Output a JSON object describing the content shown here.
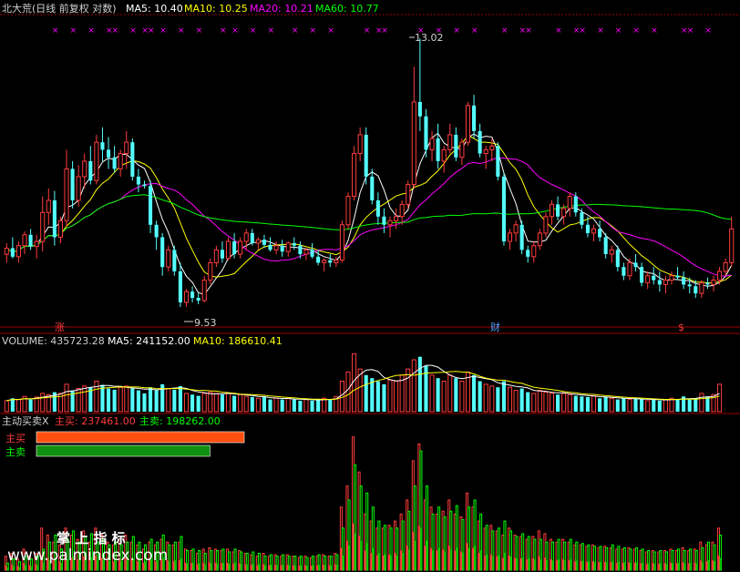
{
  "colors": {
    "up": "#ff3c3c",
    "down": "#54ffff",
    "ma5": "#ffffff",
    "ma10": "#ffff00",
    "ma20": "#ff00ff",
    "ma60": "#00ff00",
    "buy": "#ff3c10",
    "sell": "#10b010",
    "grid": "#9b0000",
    "label": "#d0d0d0"
  },
  "price_panel": {
    "title": "北大荒(日线 前复权 对数)",
    "ma5": "MA5: 10.40",
    "ma10": "MA10: 10.25",
    "ma20": "MA20: 10.21",
    "ma60": "MA60: 10.77",
    "high_label": "13.02",
    "low_label": "9.53",
    "marker_zhang": "涨",
    "marker_cai": "财",
    "marker_dollar": "$"
  },
  "volume_panel": {
    "title": "VOLUME: 435723.28",
    "ma5": "MA5: 241152.00",
    "ma10": "MA10: 186610.41"
  },
  "flow_panel": {
    "title": "主动买卖X",
    "buy_label": "主买: 237461.00",
    "sell_label": "主卖: 198262.00",
    "legend_buy": "主买",
    "legend_sell": "主卖",
    "buy_value": 237461.0,
    "sell_value": 198262.0
  },
  "watermark": {
    "line1": "掌 上 指 标",
    "line2": "www.palmindex.com"
  },
  "chart_data": {
    "type": "candlestick",
    "log_scale": true,
    "ylim": [
      9.4,
      13.3
    ],
    "price_high": 13.02,
    "price_low": 9.53,
    "candles": [
      [
        10.15,
        10.28,
        10.05,
        10.22
      ],
      [
        10.22,
        10.35,
        10.1,
        10.12
      ],
      [
        10.12,
        10.3,
        10.05,
        10.25
      ],
      [
        10.25,
        10.42,
        10.15,
        10.38
      ],
      [
        10.38,
        10.45,
        10.2,
        10.24
      ],
      [
        10.24,
        10.38,
        10.1,
        10.3
      ],
      [
        10.3,
        10.85,
        10.18,
        10.65
      ],
      [
        10.65,
        10.95,
        10.5,
        10.8
      ],
      [
        10.8,
        10.92,
        10.25,
        10.35
      ],
      [
        10.35,
        10.6,
        10.28,
        10.55
      ],
      [
        10.55,
        11.45,
        10.48,
        11.2
      ],
      [
        11.2,
        11.3,
        10.7,
        10.8
      ],
      [
        10.8,
        11.25,
        10.72,
        11.1
      ],
      [
        11.1,
        11.4,
        10.95,
        11.3
      ],
      [
        11.3,
        11.5,
        11.0,
        11.05
      ],
      [
        11.05,
        11.65,
        11.0,
        11.55
      ],
      [
        11.55,
        11.75,
        11.3,
        11.45
      ],
      [
        11.45,
        11.62,
        11.2,
        11.35
      ],
      [
        11.35,
        11.5,
        11.15,
        11.2
      ],
      [
        11.2,
        11.45,
        11.1,
        11.4
      ],
      [
        11.4,
        11.7,
        11.2,
        11.55
      ],
      [
        11.55,
        11.6,
        11.05,
        11.1
      ],
      [
        11.1,
        11.2,
        10.9,
        11.0
      ],
      [
        11.0,
        11.05,
        10.95,
        10.98
      ],
      [
        10.98,
        11.05,
        10.4,
        10.5
      ],
      [
        10.5,
        10.55,
        10.2,
        10.35
      ],
      [
        10.35,
        10.4,
        9.9,
        10.0
      ],
      [
        10.0,
        10.25,
        9.95,
        10.2
      ],
      [
        10.2,
        10.25,
        9.9,
        9.95
      ],
      [
        9.95,
        10.05,
        9.55,
        9.6
      ],
      [
        9.6,
        9.75,
        9.55,
        9.72
      ],
      [
        9.72,
        9.78,
        9.6,
        9.65
      ],
      [
        9.65,
        9.7,
        9.58,
        9.62
      ],
      [
        9.62,
        9.9,
        9.6,
        9.85
      ],
      [
        9.85,
        10.1,
        9.8,
        10.05
      ],
      [
        10.05,
        10.25,
        10.0,
        10.2
      ],
      [
        10.2,
        10.3,
        10.05,
        10.1
      ],
      [
        10.1,
        10.35,
        10.08,
        10.3
      ],
      [
        10.3,
        10.4,
        10.1,
        10.15
      ],
      [
        10.15,
        10.35,
        10.1,
        10.3
      ],
      [
        10.3,
        10.45,
        10.2,
        10.4
      ],
      [
        10.4,
        10.45,
        10.25,
        10.28
      ],
      [
        10.28,
        10.35,
        10.2,
        10.32
      ],
      [
        10.32,
        10.38,
        10.22,
        10.26
      ],
      [
        10.26,
        10.35,
        10.18,
        10.2
      ],
      [
        10.2,
        10.3,
        10.15,
        10.25
      ],
      [
        10.25,
        10.32,
        10.12,
        10.18
      ],
      [
        10.18,
        10.3,
        10.12,
        10.28
      ],
      [
        10.28,
        10.35,
        10.2,
        10.25
      ],
      [
        10.25,
        10.3,
        10.1,
        10.15
      ],
      [
        10.15,
        10.22,
        10.08,
        10.2
      ],
      [
        10.2,
        10.28,
        10.1,
        10.12
      ],
      [
        10.12,
        10.2,
        10.02,
        10.05
      ],
      [
        10.05,
        10.1,
        9.95,
        10.08
      ],
      [
        10.08,
        10.15,
        10.0,
        10.05
      ],
      [
        10.05,
        10.12,
        10.0,
        10.08
      ],
      [
        10.08,
        10.55,
        10.05,
        10.5
      ],
      [
        10.5,
        10.9,
        10.45,
        10.85
      ],
      [
        10.85,
        11.5,
        10.8,
        11.4
      ],
      [
        11.4,
        11.75,
        11.3,
        11.65
      ],
      [
        11.65,
        11.75,
        11.0,
        11.1
      ],
      [
        11.1,
        11.2,
        10.75,
        10.8
      ],
      [
        10.8,
        10.9,
        10.5,
        10.6
      ],
      [
        10.6,
        10.7,
        10.4,
        10.5
      ],
      [
        10.5,
        10.6,
        10.35,
        10.55
      ],
      [
        10.55,
        10.7,
        10.45,
        10.6
      ],
      [
        10.6,
        10.8,
        10.5,
        10.75
      ],
      [
        10.75,
        11.05,
        10.7,
        11.0
      ],
      [
        11.0,
        12.6,
        10.95,
        12.1
      ],
      [
        12.1,
        13.02,
        11.7,
        11.9
      ],
      [
        11.9,
        12.0,
        11.35,
        11.45
      ],
      [
        11.45,
        11.7,
        11.3,
        11.6
      ],
      [
        11.6,
        11.8,
        11.2,
        11.3
      ],
      [
        11.3,
        11.5,
        11.15,
        11.45
      ],
      [
        11.45,
        11.8,
        11.4,
        11.65
      ],
      [
        11.65,
        11.75,
        11.3,
        11.35
      ],
      [
        11.35,
        11.6,
        11.25,
        11.55
      ],
      [
        11.55,
        12.1,
        11.5,
        12.05
      ],
      [
        12.05,
        12.2,
        11.6,
        11.7
      ],
      [
        11.7,
        11.8,
        11.35,
        11.4
      ],
      [
        11.4,
        11.5,
        11.2,
        11.45
      ],
      [
        11.45,
        11.6,
        11.3,
        11.5
      ],
      [
        11.5,
        11.55,
        11.05,
        11.1
      ],
      [
        11.1,
        11.15,
        10.25,
        10.3
      ],
      [
        10.3,
        10.45,
        10.2,
        10.4
      ],
      [
        10.4,
        10.55,
        10.3,
        10.5
      ],
      [
        10.5,
        10.55,
        10.15,
        10.2
      ],
      [
        10.2,
        10.25,
        10.05,
        10.12
      ],
      [
        10.12,
        10.3,
        10.05,
        10.25
      ],
      [
        10.25,
        10.45,
        10.2,
        10.4
      ],
      [
        10.4,
        10.65,
        10.35,
        10.6
      ],
      [
        10.6,
        10.8,
        10.5,
        10.75
      ],
      [
        10.75,
        10.85,
        10.55,
        10.6
      ],
      [
        10.6,
        10.75,
        10.5,
        10.7
      ],
      [
        10.7,
        10.9,
        10.6,
        10.85
      ],
      [
        10.85,
        10.9,
        10.6,
        10.65
      ],
      [
        10.65,
        10.7,
        10.45,
        10.5
      ],
      [
        10.5,
        10.6,
        10.35,
        10.4
      ],
      [
        10.4,
        10.5,
        10.3,
        10.45
      ],
      [
        10.45,
        10.55,
        10.3,
        10.35
      ],
      [
        10.35,
        10.4,
        10.1,
        10.15
      ],
      [
        10.15,
        10.25,
        10.05,
        10.2
      ],
      [
        10.2,
        10.25,
        9.95,
        10.0
      ],
      [
        10.0,
        10.05,
        9.85,
        9.9
      ],
      [
        9.9,
        10.1,
        9.85,
        10.05
      ],
      [
        10.05,
        10.15,
        9.95,
        10.0
      ],
      [
        10.0,
        10.05,
        9.78,
        9.82
      ],
      [
        9.82,
        9.95,
        9.75,
        9.9
      ],
      [
        9.9,
        10.0,
        9.8,
        9.85
      ],
      [
        9.85,
        9.95,
        9.72,
        9.8
      ],
      [
        9.8,
        9.9,
        9.7,
        9.85
      ],
      [
        9.85,
        9.95,
        9.8,
        9.9
      ],
      [
        9.9,
        10.0,
        9.85,
        9.88
      ],
      [
        9.88,
        9.95,
        9.75,
        9.8
      ],
      [
        9.8,
        9.88,
        9.7,
        9.78
      ],
      [
        9.78,
        9.85,
        9.65,
        9.7
      ],
      [
        9.7,
        9.85,
        9.65,
        9.82
      ],
      [
        9.82,
        9.88,
        9.75,
        9.8
      ],
      [
        9.8,
        9.9,
        9.72,
        9.85
      ],
      [
        9.85,
        10.0,
        9.8,
        9.95
      ],
      [
        9.95,
        10.1,
        9.9,
        10.05
      ],
      [
        10.05,
        10.6,
        10.0,
        10.45
      ]
    ],
    "volume": [
      0.18,
      0.22,
      0.2,
      0.25,
      0.2,
      0.24,
      0.3,
      0.28,
      0.32,
      0.3,
      0.45,
      0.35,
      0.38,
      0.42,
      0.4,
      0.5,
      0.44,
      0.38,
      0.36,
      0.4,
      0.42,
      0.38,
      0.35,
      0.3,
      0.4,
      0.35,
      0.45,
      0.38,
      0.36,
      0.42,
      0.3,
      0.28,
      0.26,
      0.3,
      0.32,
      0.3,
      0.28,
      0.3,
      0.26,
      0.28,
      0.25,
      0.24,
      0.22,
      0.24,
      0.2,
      0.22,
      0.2,
      0.22,
      0.2,
      0.18,
      0.2,
      0.18,
      0.2,
      0.22,
      0.2,
      0.25,
      0.5,
      0.65,
      0.95,
      0.7,
      0.6,
      0.55,
      0.5,
      0.45,
      0.52,
      0.5,
      0.6,
      0.7,
      0.85,
      0.9,
      0.75,
      0.6,
      0.55,
      0.5,
      0.6,
      0.55,
      0.5,
      0.65,
      0.6,
      0.5,
      0.45,
      0.42,
      0.4,
      0.5,
      0.4,
      0.35,
      0.38,
      0.32,
      0.3,
      0.35,
      0.32,
      0.3,
      0.28,
      0.3,
      0.28,
      0.26,
      0.25,
      0.24,
      0.26,
      0.22,
      0.24,
      0.22,
      0.2,
      0.22,
      0.2,
      0.22,
      0.2,
      0.18,
      0.2,
      0.18,
      0.2,
      0.22,
      0.2,
      0.25,
      0.2,
      0.22,
      0.3,
      0.25,
      0.28,
      0.45
    ],
    "flow": [
      [
        0.1,
        0.05
      ],
      [
        0.12,
        0.08
      ],
      [
        0.08,
        0.06
      ],
      [
        0.15,
        0.1
      ],
      [
        0.1,
        0.08
      ],
      [
        0.12,
        0.1
      ],
      [
        0.3,
        0.15
      ],
      [
        0.25,
        0.2
      ],
      [
        0.2,
        0.25
      ],
      [
        0.18,
        0.15
      ],
      [
        0.3,
        0.22
      ],
      [
        0.25,
        0.28
      ],
      [
        0.22,
        0.2
      ],
      [
        0.28,
        0.24
      ],
      [
        0.2,
        0.26
      ],
      [
        0.3,
        0.2
      ],
      [
        0.25,
        0.22
      ],
      [
        0.2,
        0.18
      ],
      [
        0.18,
        0.2
      ],
      [
        0.22,
        0.18
      ],
      [
        0.25,
        0.2
      ],
      [
        0.2,
        0.24
      ],
      [
        0.18,
        0.2
      ],
      [
        0.15,
        0.18
      ],
      [
        0.2,
        0.22
      ],
      [
        0.18,
        0.2
      ],
      [
        0.22,
        0.25
      ],
      [
        0.2,
        0.18
      ],
      [
        0.18,
        0.2
      ],
      [
        0.2,
        0.24
      ],
      [
        0.15,
        0.14
      ],
      [
        0.14,
        0.15
      ],
      [
        0.12,
        0.14
      ],
      [
        0.15,
        0.12
      ],
      [
        0.16,
        0.14
      ],
      [
        0.15,
        0.14
      ],
      [
        0.14,
        0.15
      ],
      [
        0.15,
        0.13
      ],
      [
        0.13,
        0.15
      ],
      [
        0.14,
        0.13
      ],
      [
        0.12,
        0.12
      ],
      [
        0.11,
        0.13
      ],
      [
        0.1,
        0.12
      ],
      [
        0.12,
        0.1
      ],
      [
        0.1,
        0.11
      ],
      [
        0.11,
        0.1
      ],
      [
        0.1,
        0.11
      ],
      [
        0.11,
        0.1
      ],
      [
        0.1,
        0.1
      ],
      [
        0.09,
        0.1
      ],
      [
        0.1,
        0.09
      ],
      [
        0.09,
        0.1
      ],
      [
        0.1,
        0.11
      ],
      [
        0.11,
        0.1
      ],
      [
        0.1,
        0.1
      ],
      [
        0.12,
        0.11
      ],
      [
        0.45,
        0.3
      ],
      [
        0.6,
        0.5
      ],
      [
        0.95,
        0.75
      ],
      [
        0.7,
        0.6
      ],
      [
        0.4,
        0.55
      ],
      [
        0.35,
        0.45
      ],
      [
        0.3,
        0.35
      ],
      [
        0.3,
        0.32
      ],
      [
        0.32,
        0.3
      ],
      [
        0.35,
        0.3
      ],
      [
        0.4,
        0.35
      ],
      [
        0.5,
        0.42
      ],
      [
        0.78,
        0.6
      ],
      [
        0.9,
        0.85
      ],
      [
        0.5,
        0.6
      ],
      [
        0.45,
        0.4
      ],
      [
        0.4,
        0.45
      ],
      [
        0.42,
        0.38
      ],
      [
        0.5,
        0.42
      ],
      [
        0.4,
        0.46
      ],
      [
        0.38,
        0.36
      ],
      [
        0.55,
        0.45
      ],
      [
        0.45,
        0.5
      ],
      [
        0.35,
        0.4
      ],
      [
        0.3,
        0.32
      ],
      [
        0.32,
        0.28
      ],
      [
        0.28,
        0.3
      ],
      [
        0.25,
        0.35
      ],
      [
        0.3,
        0.28
      ],
      [
        0.25,
        0.24
      ],
      [
        0.24,
        0.26
      ],
      [
        0.22,
        0.24
      ],
      [
        0.24,
        0.22
      ],
      [
        0.28,
        0.22
      ],
      [
        0.26,
        0.2
      ],
      [
        0.22,
        0.2
      ],
      [
        0.2,
        0.22
      ],
      [
        0.22,
        0.2
      ],
      [
        0.2,
        0.22
      ],
      [
        0.18,
        0.2
      ],
      [
        0.18,
        0.19
      ],
      [
        0.17,
        0.18
      ],
      [
        0.18,
        0.17
      ],
      [
        0.16,
        0.17
      ],
      [
        0.17,
        0.16
      ],
      [
        0.16,
        0.18
      ],
      [
        0.15,
        0.17
      ],
      [
        0.15,
        0.16
      ],
      [
        0.16,
        0.15
      ],
      [
        0.15,
        0.16
      ],
      [
        0.14,
        0.15
      ],
      [
        0.13,
        0.14
      ],
      [
        0.14,
        0.13
      ],
      [
        0.13,
        0.14
      ],
      [
        0.14,
        0.13
      ],
      [
        0.15,
        0.14
      ],
      [
        0.14,
        0.15
      ],
      [
        0.16,
        0.14
      ],
      [
        0.14,
        0.15
      ],
      [
        0.15,
        0.14
      ],
      [
        0.2,
        0.16
      ],
      [
        0.18,
        0.2
      ],
      [
        0.2,
        0.18
      ],
      [
        0.3,
        0.25
      ]
    ]
  }
}
